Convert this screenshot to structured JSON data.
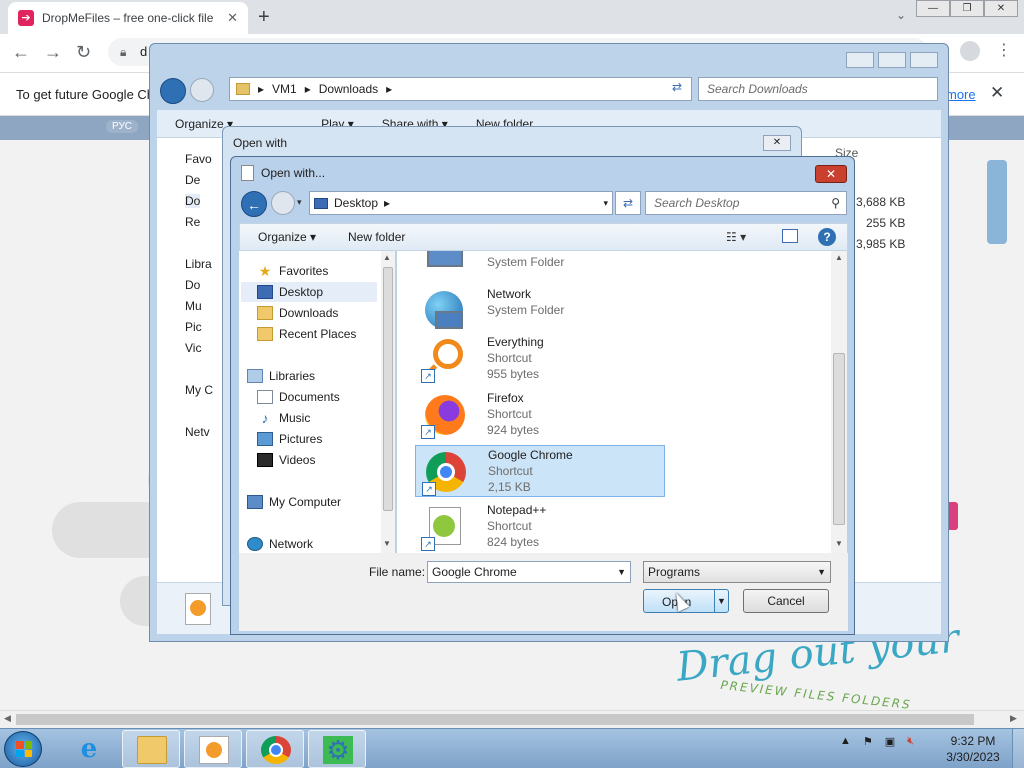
{
  "browser": {
    "tab_title": "DropMeFiles – free one-click file",
    "address_visible": "d",
    "infobar_text": "To get future Google Ch",
    "infobar_link": "more",
    "win_minimize": "—",
    "win_restore": "❐",
    "win_close": "✕"
  },
  "page": {
    "drag_text": "Drag out your",
    "drag_sub": "PREVIEW  FILES  FOLDERS",
    "left_logo": "РУС"
  },
  "explorer": {
    "breadcrumb": [
      "VM1",
      "Downloads"
    ],
    "search_placeholder": "Search Downloads",
    "cmd": {
      "organize": "Organize ▾",
      "play": "Play ▾",
      "share": "Share with ▾",
      "new_folder": "New folder"
    },
    "nav": [
      "Favo",
      "De",
      "Do",
      "Re",
      "Libra",
      "Do",
      "Mu",
      "Pic",
      "Vic",
      "My C",
      "Netv"
    ],
    "size_header": "Size",
    "sizes": [
      "3,688 KB",
      "255 KB",
      "3,985 KB"
    ]
  },
  "openwith_small": {
    "title": "Open with",
    "close": "✕"
  },
  "dialog": {
    "title": "Open with...",
    "close": "✕",
    "address": "Desktop",
    "search_placeholder": "Search Desktop",
    "cmd": {
      "organize": "Organize ▾",
      "new_folder": "New folder",
      "help": "?"
    },
    "nav": {
      "favorites": "Favorites",
      "desktop": "Desktop",
      "downloads": "Downloads",
      "recent": "Recent Places",
      "libraries": "Libraries",
      "documents": "Documents",
      "music": "Music",
      "pictures": "Pictures",
      "videos": "Videos",
      "computer": "My Computer",
      "network": "Network"
    },
    "files": [
      {
        "name": "",
        "type": "System Folder",
        "size": ""
      },
      {
        "name": "Network",
        "type": "System Folder",
        "size": ""
      },
      {
        "name": "Everything",
        "type": "Shortcut",
        "size": "955 bytes"
      },
      {
        "name": "Firefox",
        "type": "Shortcut",
        "size": "924 bytes"
      },
      {
        "name": "Google Chrome",
        "type": "Shortcut",
        "size": "2,15 KB"
      },
      {
        "name": "Notepad++",
        "type": "Shortcut",
        "size": "824 bytes"
      }
    ],
    "file_name_label": "File name:",
    "file_name_value": "Google Chrome",
    "filter": "Programs",
    "open_label": "Open",
    "cancel_label": "Cancel"
  },
  "taskbar": {
    "time": "9:32 PM",
    "date": "3/30/2023"
  },
  "colors": {
    "accent": "#2f6fb4",
    "selection": "#cce4f7",
    "close_red": "#c9402e"
  }
}
